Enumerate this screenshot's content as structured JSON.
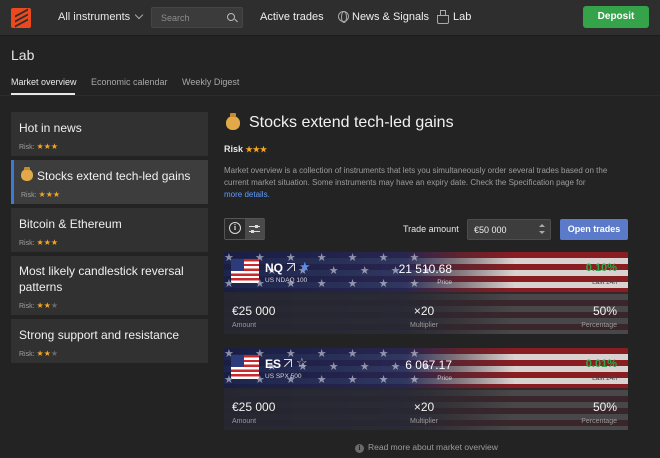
{
  "topbar": {
    "instruments_label": "All instruments",
    "search_placeholder": "Search",
    "active_trades": "Active trades",
    "news_signals": "News & Signals",
    "lab": "Lab",
    "deposit": "Deposit"
  },
  "page": {
    "title": "Lab",
    "tabs": [
      "Market overview",
      "Economic calendar",
      "Weekly Digest"
    ],
    "active_tab": "Market overview"
  },
  "overviews": [
    {
      "title": "Hot in news",
      "risk_label": "Risk:",
      "risk": 3,
      "selected": false
    },
    {
      "title": "Stocks extend tech-led gains",
      "risk_label": "Risk:",
      "risk": 3,
      "selected": true
    },
    {
      "title": "Bitcoin & Ethereum",
      "risk_label": "Risk:",
      "risk": 3,
      "selected": false
    },
    {
      "title": "Most likely candlestick reversal patterns",
      "risk_label": "Risk:",
      "risk": 2,
      "selected": false
    },
    {
      "title": "Strong support and resistance",
      "risk_label": "Risk:",
      "risk": 2,
      "selected": false
    }
  ],
  "detail": {
    "title": "Stocks extend tech-led gains",
    "risk_label": "Risk",
    "risk": 3,
    "description": "Market overview is a collection of instruments that lets you simultaneously order several trades based on the current market situation. Some instruments may have an expiry date. Check the Specification page for",
    "more_link": "more details.",
    "trade_amount_label": "Trade amount",
    "trade_amount_value": "€50 000",
    "open_trades": "Open trades",
    "read_more": "Read more about market overview"
  },
  "instruments": [
    {
      "symbol": "NQ",
      "name": "US NDAQ 100",
      "price": "21 510.68",
      "price_label": "Price",
      "change": "0.10%",
      "change_label": "Last 24h",
      "amount": "€25 000",
      "amount_label": "Amount",
      "multiplier": "×20",
      "multiplier_label": "Multiplier",
      "percentage": "50%",
      "percentage_label": "Percentage"
    },
    {
      "symbol": "ES",
      "name": "US SPX 500",
      "price": "6 067.17",
      "price_label": "Price",
      "change": "0.01%",
      "change_label": "Last 24h",
      "amount": "€25 000",
      "amount_label": "Amount",
      "multiplier": "×20",
      "multiplier_label": "Multiplier",
      "percentage": "50%",
      "percentage_label": "Percentage"
    }
  ],
  "colors": {
    "accent": "#3d7ad6",
    "deposit": "#35a34a",
    "star": "#f5a623",
    "positive": "#35a34a",
    "open_button": "#5b7ac9"
  },
  "icons": [
    "logo-icon",
    "chevron-down-icon",
    "search-icon",
    "globe-icon",
    "flask-icon",
    "money-bag-icon",
    "info-icon",
    "sliders-icon",
    "stepper-icon",
    "us-flag-icon",
    "external-link-icon",
    "star-icon"
  ]
}
